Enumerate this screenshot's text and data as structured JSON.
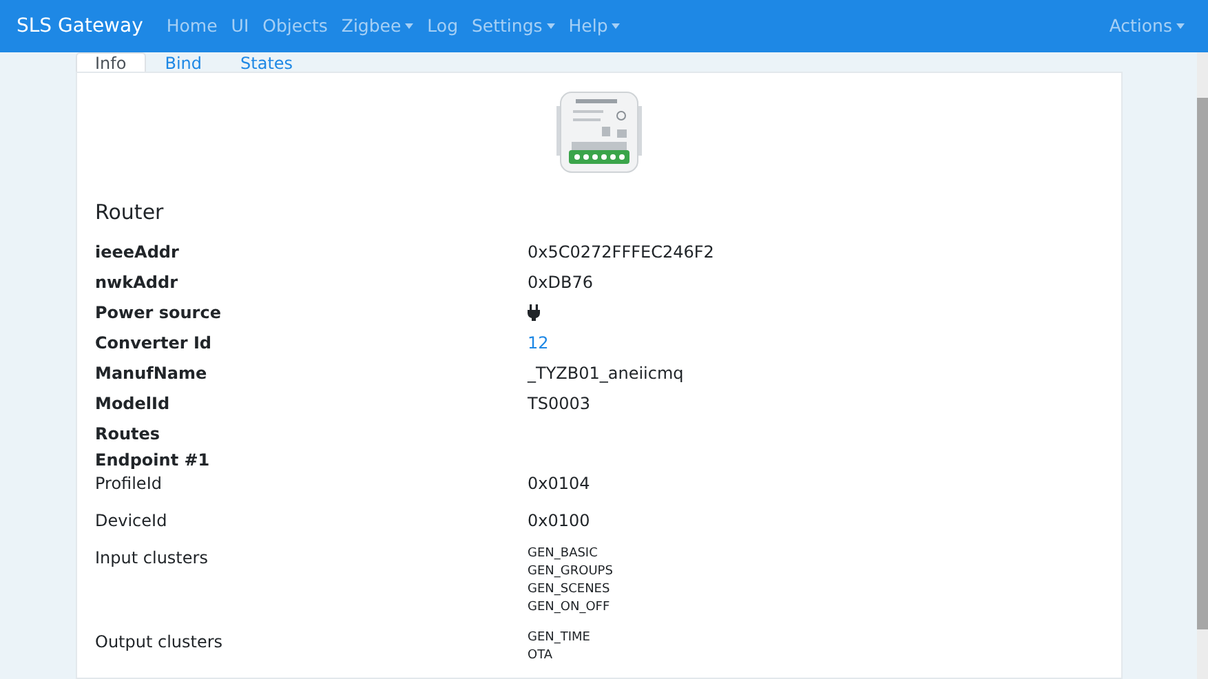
{
  "navbar": {
    "brand": "SLS Gateway",
    "items": [
      {
        "label": "Home",
        "dropdown": false
      },
      {
        "label": "UI",
        "dropdown": false
      },
      {
        "label": "Objects",
        "dropdown": false
      },
      {
        "label": "Zigbee",
        "dropdown": true
      },
      {
        "label": "Log",
        "dropdown": false
      },
      {
        "label": "Settings",
        "dropdown": true
      },
      {
        "label": "Help",
        "dropdown": true
      }
    ],
    "actions": {
      "label": "Actions",
      "dropdown": true
    }
  },
  "tabs": [
    {
      "label": "Info",
      "selected": true
    },
    {
      "label": "Bind",
      "selected": false
    },
    {
      "label": "States",
      "selected": false
    }
  ],
  "device": {
    "type": "Router"
  },
  "rows": [
    {
      "label": "ieeeAddr",
      "kind": "bold",
      "value": {
        "kind": "text",
        "text": "0x5C0272FFFEC246F2"
      }
    },
    {
      "label": "nwkAddr",
      "kind": "bold",
      "value": {
        "kind": "text",
        "text": "0xDB76"
      }
    },
    {
      "label": "Power source",
      "kind": "bold",
      "value": {
        "kind": "icon"
      }
    },
    {
      "label": "Converter Id",
      "kind": "bold",
      "value": {
        "kind": "link",
        "text": "12"
      }
    },
    {
      "label": "ManufName",
      "kind": "bold",
      "value": {
        "kind": "text",
        "text": "_TYZB01_aneiicmq"
      }
    },
    {
      "label": "ModelId",
      "kind": "bold",
      "value": {
        "kind": "text",
        "text": "TS0003"
      }
    },
    {
      "label": "Routes",
      "kind": "bold"
    },
    {
      "label": "Endpoint #1",
      "kind": "heading"
    },
    {
      "label": "ProfileId",
      "kind": "plain",
      "value": {
        "kind": "text",
        "text": "0x0104"
      }
    },
    {
      "label": "DeviceId",
      "kind": "plain",
      "value": {
        "kind": "text",
        "text": "0x0100"
      }
    },
    {
      "label": "Input clusters",
      "kind": "plain",
      "value": {
        "kind": "list",
        "items": [
          "GEN_BASIC",
          "GEN_GROUPS",
          "GEN_SCENES",
          "GEN_ON_OFF"
        ]
      }
    },
    {
      "label": "Output clusters",
      "kind": "plain",
      "value": {
        "kind": "list",
        "items": [
          "GEN_TIME",
          "OTA"
        ]
      }
    }
  ]
}
